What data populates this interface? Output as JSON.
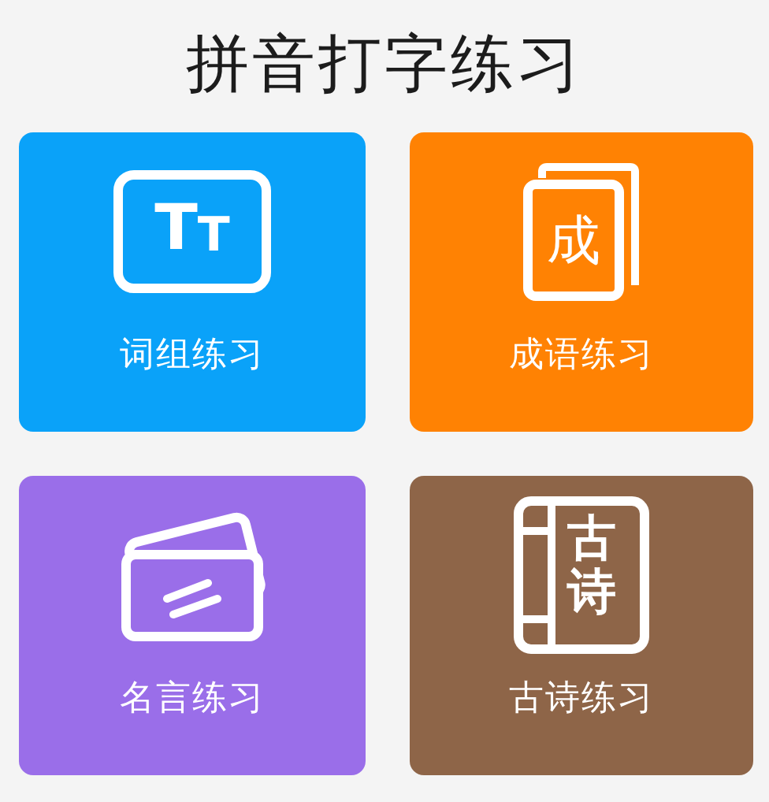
{
  "title": "拼音打字练习",
  "rows": [
    {
      "cards": [
        {
          "kind": "letters",
          "label": "词组练习",
          "icon_text": "TT",
          "color": "#0aa2f9"
        },
        {
          "kind": "book",
          "label": "成语练习",
          "icon_text": "成",
          "color": "#ff8203"
        }
      ]
    },
    {
      "cards": [
        {
          "kind": "cards",
          "label": "名言练习",
          "color": "#9a6ee9"
        },
        {
          "kind": "bound",
          "label": "古诗练习",
          "icon_text": "古诗",
          "color": "#8e6548"
        }
      ]
    }
  ]
}
